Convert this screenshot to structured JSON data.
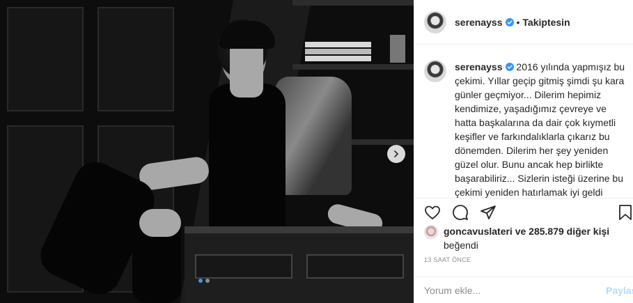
{
  "post": {
    "username": "serenayss",
    "follow_status": "Takiptesin",
    "caption_user": "serenayss",
    "caption": "2016 yılında yapmışız bu çekimi. Yıllar geçip gitmiş şimdi şu kara günler geçmiyor... Dilerim hepimiz kendimize, yaşadığımız çevreye ve hatta başkalarına da dair çok kıymetli keşifler ve farkındalıklarla çıkarız bu dönemden. Dilerim her şey yeniden güzel olur. Bunu ancak hep birlikte başarabiliriz... Sizlerin isteği üzerine bu çekimi yeniden hatırlamak iyi geldi",
    "liked_by_user": "goncavuslateri",
    "liked_by_rest": "ve 285.879 diğer kişi",
    "liked_suffix": "beğendi",
    "time": "13 SAAT ÖNCE",
    "carousel_index": 1,
    "carousel_total": 2
  },
  "comment": {
    "placeholder": "Yorum ekle...",
    "share_label": "Paylaş"
  },
  "colors": {
    "verified": "#3897f0",
    "accent": "#3897f0",
    "share_disabled": "#b3dbff",
    "muted": "#8e8e8e"
  },
  "icons": {
    "like": "heart-icon",
    "comment": "comment-icon",
    "share": "paper-plane-icon",
    "save": "bookmark-icon",
    "next": "chevron-right-icon",
    "verified": "verified-badge-icon"
  }
}
